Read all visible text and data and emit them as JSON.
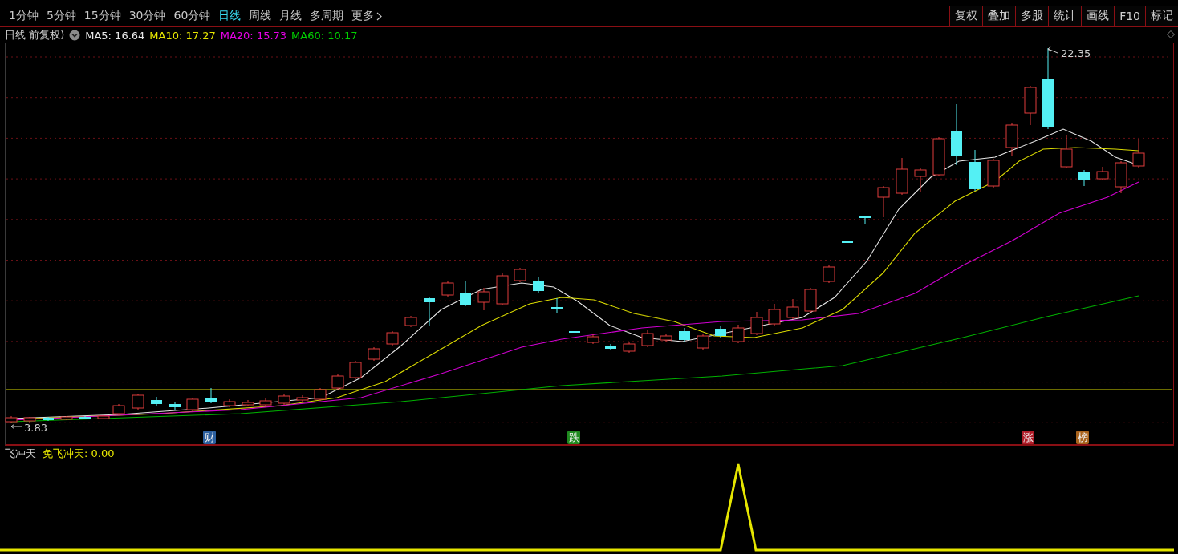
{
  "periods": [
    {
      "label": "1分钟",
      "selected": false
    },
    {
      "label": "5分钟",
      "selected": false
    },
    {
      "label": "15分钟",
      "selected": false
    },
    {
      "label": "30分钟",
      "selected": false
    },
    {
      "label": "60分钟",
      "selected": false
    },
    {
      "label": "日线",
      "selected": true
    },
    {
      "label": "周线",
      "selected": false
    },
    {
      "label": "月线",
      "selected": false
    },
    {
      "label": "多周期",
      "selected": false
    },
    {
      "label": "更多",
      "selected": false
    }
  ],
  "tools": [
    "复权",
    "叠加",
    "多股",
    "统计",
    "画线",
    "F10",
    "标记"
  ],
  "chart_header": {
    "title": "日线 前复权)",
    "indicators": [
      {
        "label": "MA5: 16.64",
        "color": "#e6e6e6"
      },
      {
        "label": "MA10: 17.27",
        "color": "#e6e600"
      },
      {
        "label": "MA20: 15.73",
        "color": "#e600e6"
      },
      {
        "label": "MA60: 10.17",
        "color": "#00d000"
      }
    ]
  },
  "price_chart": {
    "high_label": "22.35",
    "low_label": "3.83",
    "markers": [
      {
        "label": "财",
        "color": "#2c5f9e"
      },
      {
        "label": "跌",
        "color": "#1f8a1f"
      },
      {
        "label": "涨",
        "color": "#b01c28"
      },
      {
        "label": "榜",
        "color": "#a8621c"
      }
    ]
  },
  "indicator_panel": {
    "name": "飞冲天",
    "reading": "免飞冲天: 0.00"
  }
}
